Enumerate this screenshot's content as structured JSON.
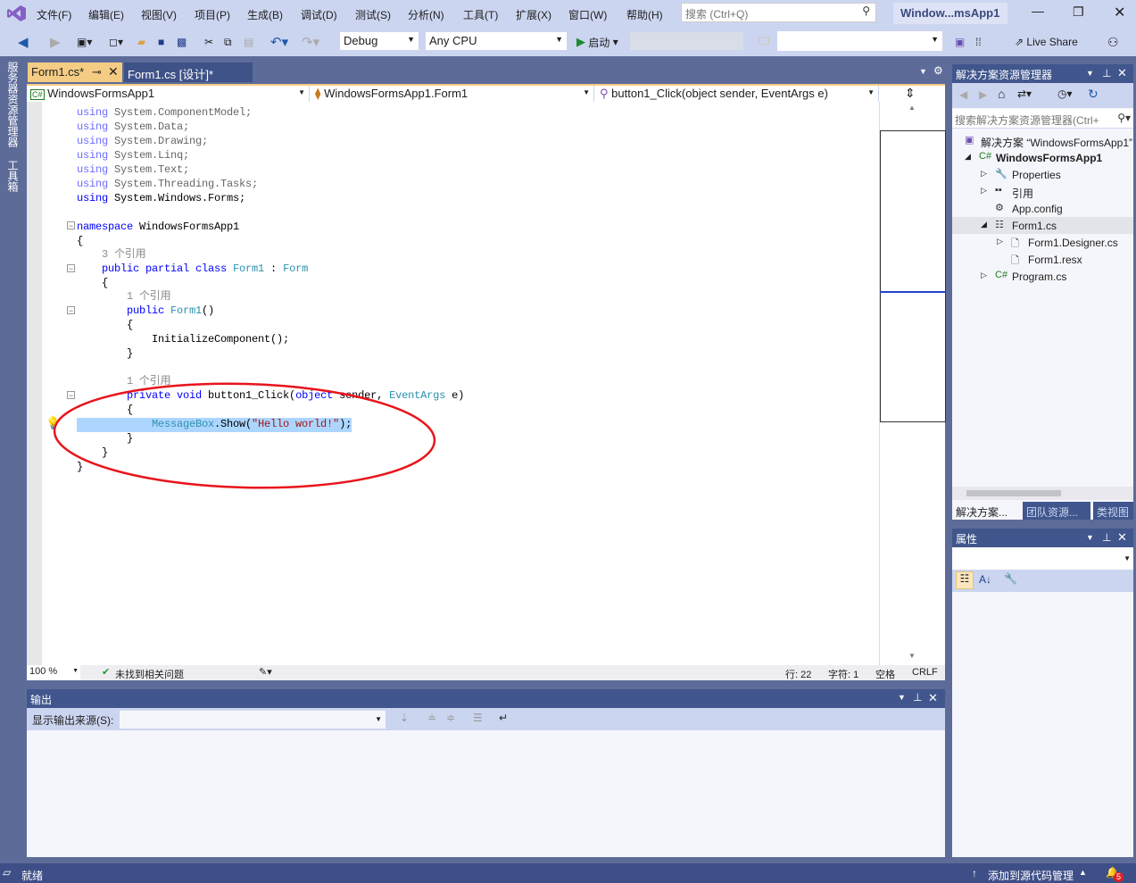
{
  "menu": [
    "文件(F)",
    "编辑(E)",
    "视图(V)",
    "项目(P)",
    "生成(B)",
    "调试(D)",
    "测试(S)",
    "分析(N)",
    "工具(T)",
    "扩展(X)",
    "窗口(W)",
    "帮助(H)"
  ],
  "search_placeholder": "搜索 (Ctrl+Q)",
  "window_title": "Window...msApp1",
  "toolbar": {
    "config": "Debug",
    "platform": "Any CPU",
    "start": "启动",
    "live_share": "Live Share"
  },
  "left_tabs": [
    "服务器资源管理器",
    "工具箱"
  ],
  "doc_tabs": [
    {
      "label": "Form1.cs*",
      "active": true
    },
    {
      "label": "Form1.cs [设计]*",
      "active": false
    }
  ],
  "nav": {
    "project": "WindowsFormsApp1",
    "class": "WindowsFormsApp1.Form1",
    "member": "button1_Click(object sender, EventArgs e)"
  },
  "code": [
    [
      [
        "kwd",
        "using"
      ],
      [
        "pld",
        " System.ComponentModel;"
      ]
    ],
    [
      [
        "kwd",
        "using"
      ],
      [
        "pld",
        " System.Data;"
      ]
    ],
    [
      [
        "kwd",
        "using"
      ],
      [
        "pld",
        " System.Drawing;"
      ]
    ],
    [
      [
        "kwd",
        "using"
      ],
      [
        "pld",
        " System.Linq;"
      ]
    ],
    [
      [
        "kwd",
        "using"
      ],
      [
        "pld",
        " System.Text;"
      ]
    ],
    [
      [
        "kwd",
        "using"
      ],
      [
        "pld",
        " System.Threading.Tasks;"
      ]
    ],
    [
      [
        "kw",
        "using"
      ],
      [
        "pl",
        " System.Windows.Forms;"
      ]
    ],
    [],
    [
      [
        "kw",
        "namespace"
      ],
      [
        "pl",
        " WindowsFormsApp1"
      ]
    ],
    [
      [
        "pl",
        "{"
      ]
    ],
    [
      [
        "lens",
        "    3 个引用"
      ]
    ],
    [
      [
        "kw",
        "    public partial class "
      ],
      [
        "ty",
        "Form1"
      ],
      [
        "pl",
        " : "
      ],
      [
        "ty",
        "Form"
      ]
    ],
    [
      [
        "pl",
        "    {"
      ]
    ],
    [
      [
        "lens",
        "        1 个引用"
      ]
    ],
    [
      [
        "kw",
        "        public "
      ],
      [
        "ty",
        "Form1"
      ],
      [
        "pl",
        "()"
      ]
    ],
    [
      [
        "pl",
        "        {"
      ]
    ],
    [
      [
        "pl",
        "            InitializeComponent();"
      ]
    ],
    [
      [
        "pl",
        "        }"
      ]
    ],
    [],
    [
      [
        "lens",
        "        1 个引用"
      ]
    ],
    [
      [
        "kw",
        "        private void "
      ],
      [
        "pl",
        "button1_Click("
      ],
      [
        "kw",
        "object"
      ],
      [
        "pl",
        " sender, "
      ],
      [
        "ty",
        "EventArgs"
      ],
      [
        "pl",
        " e)"
      ]
    ],
    [
      [
        "pl",
        "        {"
      ]
    ],
    [
      [
        "ty",
        "            MessageBox"
      ],
      [
        "pl",
        ".Show("
      ],
      [
        "st",
        "\"Hello world!\""
      ],
      [
        "pl",
        ");"
      ]
    ],
    [
      [
        "pl",
        "        }"
      ]
    ],
    [
      [
        "pl",
        "    }"
      ]
    ],
    [
      [
        "pl",
        "}"
      ]
    ]
  ],
  "editor_status": {
    "zoom": "100 %",
    "issues": "未找到相关问题",
    "line": "行: 22",
    "char": "字符: 1",
    "spaces": "空格",
    "eol": "CRLF"
  },
  "output": {
    "title": "输出",
    "source_label": "显示输出来源(S):",
    "source_value": ""
  },
  "solution_explorer": {
    "title": "解决方案资源管理器",
    "search_placeholder": "搜索解决方案资源管理器(Ctrl+",
    "items": [
      {
        "label": "解决方案 “WindowsFormsApp1”",
        "icon": "solution-icon",
        "expander": ""
      },
      {
        "label": "WindowsFormsApp1",
        "icon": "csharp-project-icon",
        "expander": "◢",
        "bold": true
      },
      {
        "label": "Properties",
        "icon": "wrench-icon",
        "expander": "▷"
      },
      {
        "label": "引用",
        "icon": "references-icon",
        "expander": "▷"
      },
      {
        "label": "App.config",
        "icon": "config-icon",
        "expander": ""
      },
      {
        "label": "Form1.cs",
        "icon": "form-icon",
        "expander": "◢",
        "selected": true
      },
      {
        "label": "Form1.Designer.cs",
        "icon": "file-icon",
        "expander": "▷"
      },
      {
        "label": "Form1.resx",
        "icon": "file-icon",
        "expander": ""
      },
      {
        "label": "Program.cs",
        "icon": "csharp-file-icon",
        "expander": "▷"
      }
    ],
    "tabs": [
      "解决方案...",
      "团队资源...",
      "类视图"
    ]
  },
  "properties": {
    "title": "属性"
  },
  "statusbar": {
    "ready": "就绪",
    "source_control": "添加到源代码管理",
    "notifications": "5"
  },
  "colors": {
    "accent": "#f5cc84",
    "selection": "#add6ff",
    "annotation": "#e8141c"
  }
}
